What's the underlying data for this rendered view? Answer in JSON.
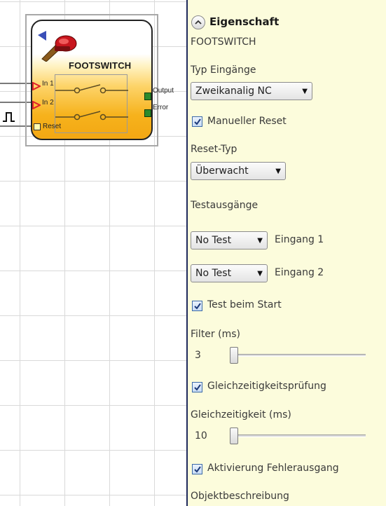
{
  "block": {
    "title": "FOOTSWITCH",
    "inputs": [
      "In 1",
      "In 2"
    ],
    "reset_label": "Reset",
    "outputs": [
      "Output",
      "Error"
    ],
    "reset_symbol": "ƒ┐"
  },
  "panel": {
    "header": "Eigenschaft",
    "object_name": "FOOTSWITCH",
    "input_type": {
      "label": "Typ Eingänge",
      "value": "Zweikanalig NC"
    },
    "manual_reset": {
      "label": "Manueller Reset",
      "checked": true
    },
    "reset_type": {
      "label": "Reset-Typ",
      "value": "Überwacht"
    },
    "test_outputs": {
      "label": "Testausgänge",
      "rows": [
        {
          "value": "No Test",
          "label": "Eingang 1"
        },
        {
          "value": "No Test",
          "label": "Eingang 2"
        }
      ]
    },
    "test_at_start": {
      "label": "Test beim Start",
      "checked": true
    },
    "filter": {
      "label": "Filter (ms)",
      "value": "3",
      "level": 0.0
    },
    "simultaneity_check": {
      "label": "Gleichzeitigkeitsprüfung",
      "checked": true
    },
    "simultaneity": {
      "label": "Gleichzeitigkeit (ms)",
      "value": "10",
      "level": 0.0
    },
    "error_output": {
      "label": "Aktivierung Fehlerausgang",
      "checked": true
    },
    "description_label": "Objektbeschreibung"
  },
  "colors": {
    "panel_bg": "#fcfcdc",
    "block_orange": "#f6b21c",
    "port_green": "#2c8a2c",
    "pin_red": "#e0202a",
    "divider": "#1f2a5c"
  }
}
